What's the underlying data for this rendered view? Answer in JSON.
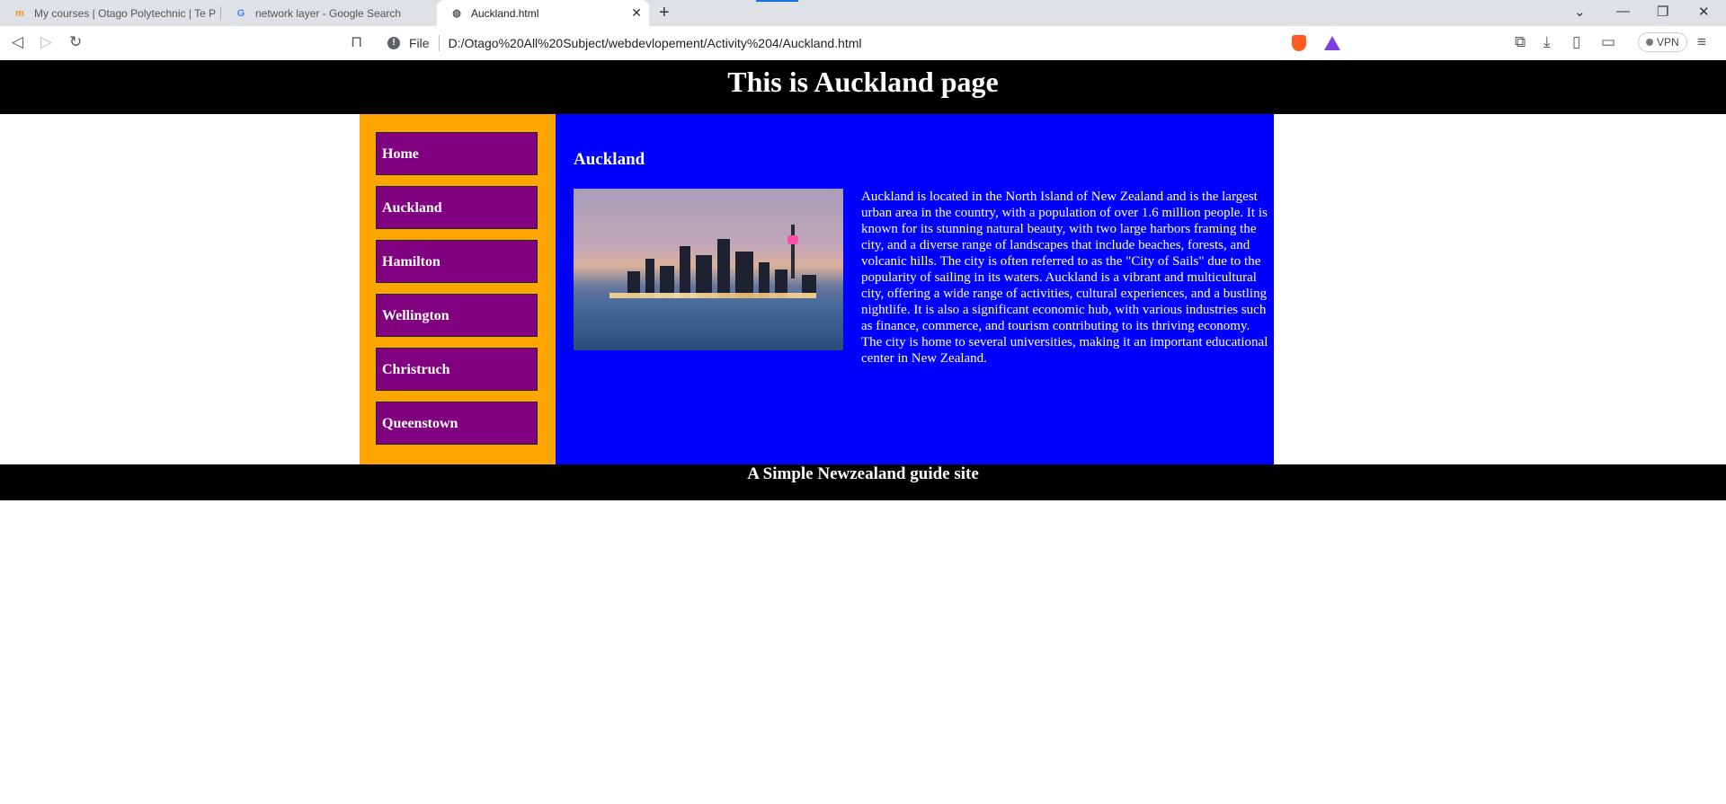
{
  "browser": {
    "tabs": [
      {
        "title": "My courses | Otago Polytechnic | Te P"
      },
      {
        "title": "network layer - Google Search"
      },
      {
        "title": "Auckland.html"
      }
    ],
    "address": {
      "scheme_label": "File",
      "url": "D:/Otago%20All%20Subject/webdevlopement/Activity%204/Auckland.html"
    },
    "vpn_label": "VPN"
  },
  "page": {
    "header_title": "This is Auckland page",
    "nav": [
      {
        "label": "Home"
      },
      {
        "label": "Auckland"
      },
      {
        "label": "Hamilton"
      },
      {
        "label": "Wellington"
      },
      {
        "label": "Christruch"
      },
      {
        "label": "Queenstown"
      }
    ],
    "main_heading": "Auckland",
    "main_text": "Auckland is located in the North Island of New Zealand and is the largest urban area in the country, with a population of over 1.6 million people. It is known for its stunning natural beauty, with two large harbors framing the city, and a diverse range of landscapes that include beaches, forests, and volcanic hills. The city is often referred to as the \"City of Sails\" due to the popularity of sailing in its waters. Auckland is a vibrant and multicultural city, offering a wide range of activities, cultural experiences, and a bustling nightlife. It is also a significant economic hub, with various industries such as finance, commerce, and tourism contributing to its thriving economy. The city is home to several universities, making it an important educational center in New Zealand.",
    "footer_text": "A Simple Newzealand guide site"
  },
  "colors": {
    "header_bg": "#000000",
    "nav_bg": "#ffa500",
    "nav_item_bg": "#800080",
    "main_bg": "#0000ff",
    "text": "#ffffff"
  }
}
